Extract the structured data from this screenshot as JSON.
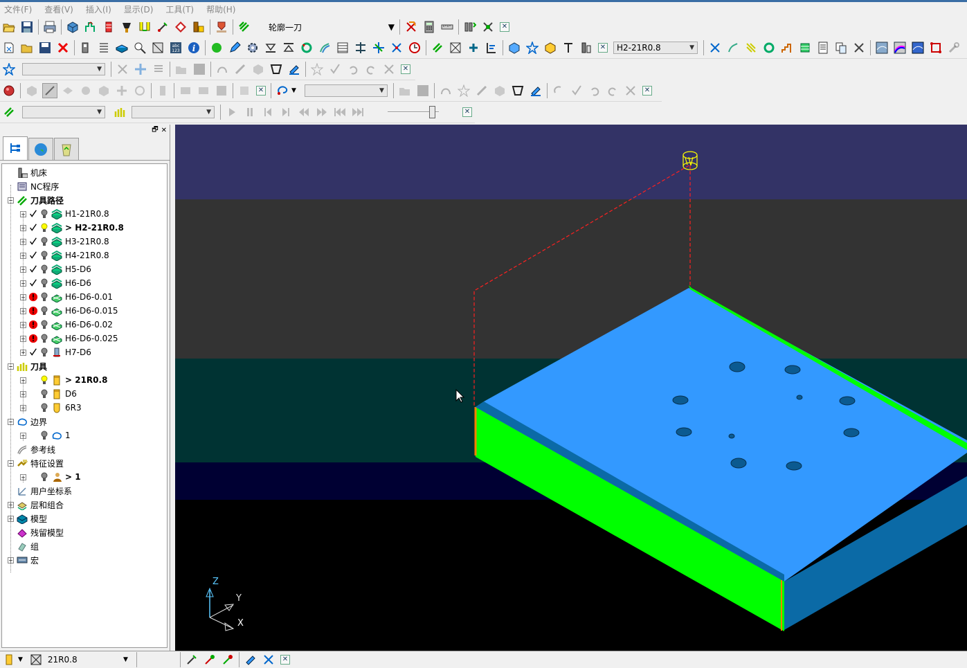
{
  "menu": [
    "文件(F)",
    "查看(V)",
    "插入(I)",
    "显示(D)",
    "工具(T)",
    "帮助(H)"
  ],
  "toolbar1": {
    "toolpath_combo": "轮廓一刀"
  },
  "toolbar2": {
    "active_toolpath_combo": "H2-21R0.8"
  },
  "explorer": {
    "tree": [
      {
        "label": "机床",
        "icon": "machine-icon",
        "level": 0,
        "bold": false
      },
      {
        "label": "NC程序",
        "icon": "nc-program-icon",
        "level": 0,
        "bold": false
      },
      {
        "label": "刀具路径",
        "icon": "toolpaths-folder-icon",
        "level": 0,
        "bold": true
      },
      {
        "label": "H1-21R0.8",
        "level": 1,
        "status": "check",
        "bulb": "off",
        "kind": "toolpath"
      },
      {
        "label": "> H2-21R0.8",
        "level": 1,
        "status": "check",
        "bulb": "on",
        "kind": "toolpath",
        "bold": true
      },
      {
        "label": "H3-21R0.8",
        "level": 1,
        "status": "check",
        "bulb": "off",
        "kind": "toolpath"
      },
      {
        "label": "H4-21R0.8",
        "level": 1,
        "status": "check",
        "bulb": "off",
        "kind": "toolpath"
      },
      {
        "label": "H5-D6",
        "level": 1,
        "status": "check",
        "bulb": "off",
        "kind": "toolpath"
      },
      {
        "label": "H6-D6",
        "level": 1,
        "status": "check",
        "bulb": "off",
        "kind": "toolpath"
      },
      {
        "label": "H6-D6-0.01",
        "level": 1,
        "status": "error",
        "bulb": "off",
        "kind": "toolpath-pending"
      },
      {
        "label": "H6-D6-0.015",
        "level": 1,
        "status": "error",
        "bulb": "off",
        "kind": "toolpath-pending"
      },
      {
        "label": "H6-D6-0.02",
        "level": 1,
        "status": "error",
        "bulb": "off",
        "kind": "toolpath-pending"
      },
      {
        "label": "H6-D6-0.025",
        "level": 1,
        "status": "error",
        "bulb": "off",
        "kind": "toolpath-pending"
      },
      {
        "label": "H7-D6",
        "level": 1,
        "status": "check",
        "bulb": "off",
        "kind": "toolpath-drill"
      },
      {
        "label": "刀具",
        "icon": "tools-folder-icon",
        "level": 0,
        "bold": true
      },
      {
        "label": "> 21R0.8",
        "level": 1,
        "bulb": "on",
        "kind": "tool",
        "bold": true
      },
      {
        "label": "D6",
        "level": 1,
        "bulb": "off",
        "kind": "tool"
      },
      {
        "label": "6R3",
        "level": 1,
        "bulb": "off",
        "kind": "tool-ball"
      },
      {
        "label": "边界",
        "icon": "boundary-icon",
        "level": 0,
        "bold": false
      },
      {
        "label": "1",
        "level": 1,
        "bulb": "off",
        "kind": "boundary"
      },
      {
        "label": "参考线",
        "icon": "pattern-icon",
        "level": 0,
        "bold": false
      },
      {
        "label": "特征设置",
        "icon": "featureset-icon",
        "level": 0,
        "bold": false
      },
      {
        "label": "> 1",
        "level": 1,
        "bulb": "off",
        "kind": "featureset",
        "bold": true
      },
      {
        "label": "用户坐标系",
        "icon": "workplane-icon",
        "level": 0,
        "bold": false
      },
      {
        "label": "层和组合",
        "icon": "layers-icon",
        "level": 0,
        "bold": false
      },
      {
        "label": "模型",
        "icon": "model-icon",
        "level": 0,
        "bold": false
      },
      {
        "label": "残留模型",
        "icon": "stock-model-icon",
        "level": 0,
        "bold": false
      },
      {
        "label": "组",
        "icon": "group-icon",
        "level": 0,
        "bold": false
      },
      {
        "label": "宏",
        "icon": "macro-icon",
        "level": 0,
        "bold": false
      }
    ]
  },
  "viewport": {
    "axis_labels": {
      "z": "Z",
      "y": "Y",
      "x": "X"
    },
    "colors": {
      "top_surface": "#3399ff",
      "side_green": "#00ff00",
      "side_dark": "#0b6aa6",
      "toolpath_rapid": "#ff2020",
      "tool": "#ffff00",
      "bg_band_1": "#333366",
      "bg_band_2": "#333333",
      "bg_band_3": "#003333",
      "bg_band_4": "#000033",
      "bg_band_5": "#000000"
    }
  },
  "statusbar": {
    "tool_combo": "21R0.8"
  }
}
